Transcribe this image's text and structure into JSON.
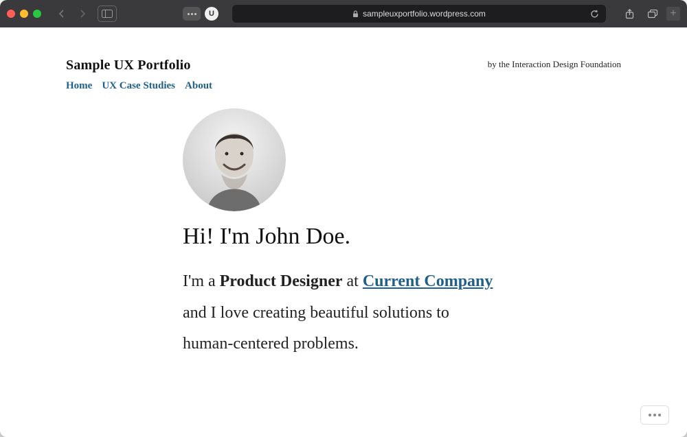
{
  "browser": {
    "url_display": "sampleuxportfolio.wordpress.com",
    "lock_state": "secure"
  },
  "site": {
    "title": "Sample UX Portfolio",
    "byline": "by the Interaction Design Foundation",
    "nav": {
      "home": "Home",
      "case_studies": "UX Case Studies",
      "about": "About"
    }
  },
  "hero": {
    "greeting": "Hi! I'm John Doe.",
    "intro_prefix": "I'm a ",
    "role": "Product Designer",
    "intro_at": " at ",
    "company": "Current Company",
    "intro_suffix_1": "and I love creating beautiful solutions to",
    "intro_suffix_2": "human-centered problems."
  },
  "colors": {
    "link": "#1f5f88"
  }
}
